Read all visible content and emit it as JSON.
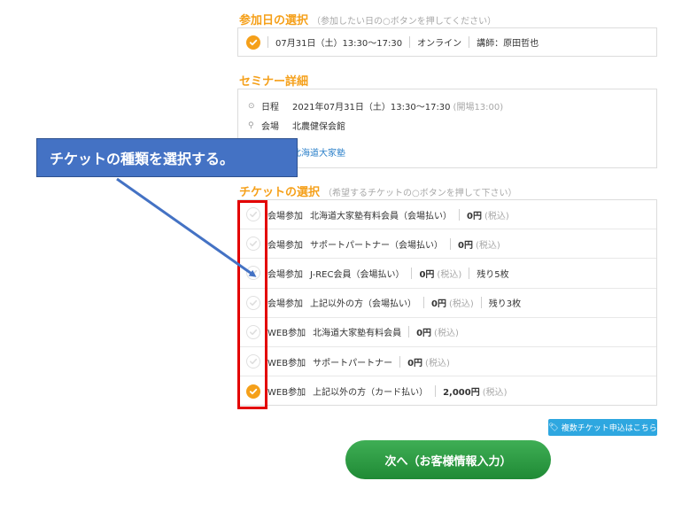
{
  "date_section": {
    "title": "参加日の選択",
    "hint": "（参加したい日の○ボタンを押してください）",
    "option": {
      "date": "07月31日（土）13:30～17:30",
      "venue": "オンライン",
      "lecturer": "講師：原田哲也",
      "selected": true
    }
  },
  "detail_section": {
    "title": "セミナー詳細",
    "date_label": "日程",
    "date_value": "2021年07月31日（土）13:30～17:30",
    "open_time": "(開場13:00)",
    "venue_label": "会場",
    "venue_value": "北農健保会館",
    "organizer": "北海道大家塾"
  },
  "ticket_section": {
    "title": "チケットの選択",
    "hint": "（希望するチケットの○ボタンを押して下さい）",
    "tickets": [
      {
        "type": "会場参加",
        "name": "北海道大家塾有料会員（会場払い）",
        "price": "0円",
        "tax": "(税込)",
        "remaining": "",
        "selected": false
      },
      {
        "type": "会場参加",
        "name": "サポートパートナー（会場払い）",
        "price": "0円",
        "tax": "(税込)",
        "remaining": "",
        "selected": false
      },
      {
        "type": "会場参加",
        "name": "J-REC会員（会場払い）",
        "price": "0円",
        "tax": "(税込)",
        "remaining": "残り5枚",
        "selected": false
      },
      {
        "type": "会場参加",
        "name": "上記以外の方（会場払い）",
        "price": "0円",
        "tax": "(税込)",
        "remaining": "残り3枚",
        "selected": false
      },
      {
        "type": "WEB参加",
        "name": "北海道大家塾有料会員",
        "price": "0円",
        "tax": "(税込)",
        "remaining": "",
        "selected": false
      },
      {
        "type": "WEB参加",
        "name": "サポートパートナー",
        "price": "0円",
        "tax": "(税込)",
        "remaining": "",
        "selected": false
      },
      {
        "type": "WEB参加",
        "name": "上記以外の方（カード払い）",
        "price": "2,000円",
        "tax": "(税込)",
        "remaining": "",
        "selected": true
      }
    ]
  },
  "annotation": {
    "text": "チケットの種類を選択する。"
  },
  "multi_ticket_button": {
    "label": "複数チケット申込はこちら",
    "icon": "tag-icon"
  },
  "next_button": {
    "label": "次へ（お客様情報入力）"
  },
  "colors": {
    "accent": "#f5a01a",
    "callout": "#4472c4",
    "highlight": "#e30000",
    "next": "#2a9a45",
    "link": "#2a7fc9"
  }
}
